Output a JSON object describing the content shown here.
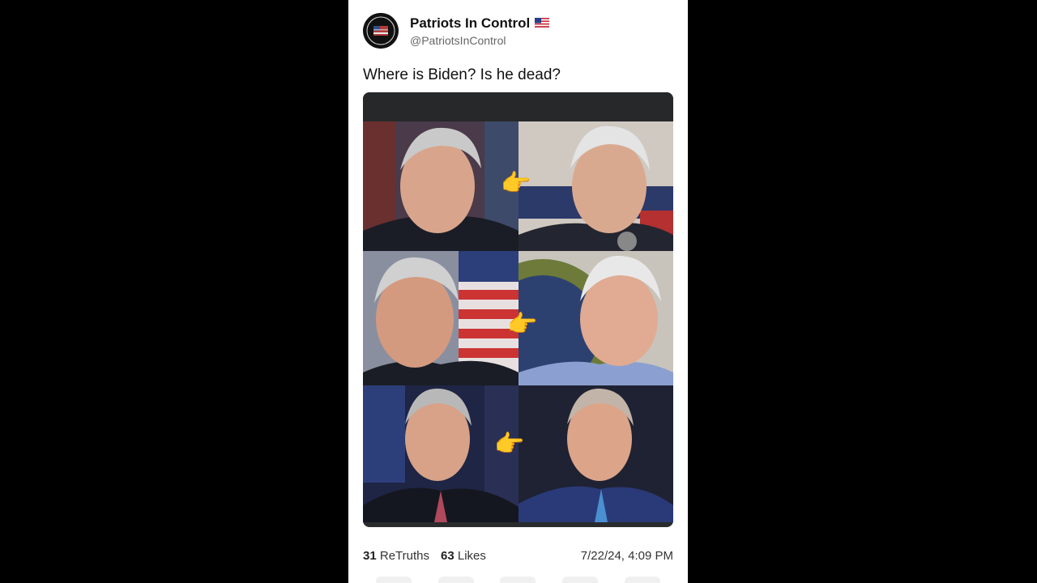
{
  "post": {
    "display_name": "Patriots In Control",
    "handle": "@PatriotsInControl",
    "text": "Where is Biden? Is he dead?",
    "retruths_count": "31",
    "retruths_label": "ReTruths",
    "likes_count": "63",
    "likes_label": "Likes",
    "timestamp": "7/22/24, 4:09 PM"
  },
  "icons": {
    "flag": "us-flag-icon",
    "pointer": "pointing-right-hand-icon",
    "avatar": "avatar"
  },
  "colors": {
    "background": "#000000",
    "card": "#ffffff",
    "media_frame": "#2a2b2d"
  }
}
